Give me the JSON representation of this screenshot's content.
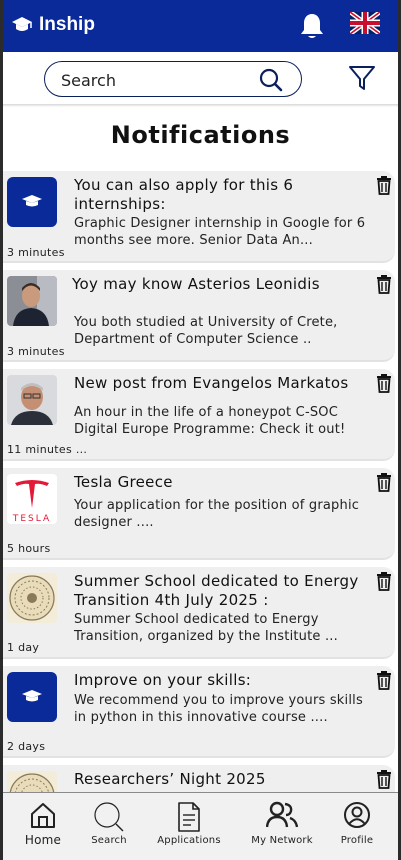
{
  "app": {
    "name": "Inship"
  },
  "search": {
    "placeholder": "Search"
  },
  "page": {
    "title": "Notifications"
  },
  "notifications": [
    {
      "title": "You can also apply for this 6 internships:",
      "body": "Graphic Designer internship in Google for 6 months see more. Senior Data An...",
      "time": "3 minutes",
      "icon": "graduation-cap-icon"
    },
    {
      "title": "Yoy may know Asterios Leonidis",
      "body": "You both studied at University of Crete, Department of Computer Science ..",
      "time": "3 minutes",
      "icon": "person-photo"
    },
    {
      "title": "New post from Evangelos  Markatos",
      "body": "An hour in the life of a honeypot C-SOC Digital Europe Programme: Check it out!",
      "time": "11 minutes ...",
      "icon": "person-photo"
    },
    {
      "title": "Tesla Greece",
      "body": "Your application for the position of graphic designer ....",
      "time": "5 hours",
      "icon": "tesla-logo",
      "logo_text": "TESLA"
    },
    {
      "title": "Summer School dedicated to Energy Transition 4th July 2025 :",
      "body": "Summer School dedicated to Energy Transition, organized by the Institute ...",
      "time": "1 day",
      "icon": "seal-logo"
    },
    {
      "title": "Improve on your skills:",
      "body": "We recommend you to improve yours skills in python in this innovative course ....",
      "time": "2 days",
      "icon": "graduation-cap-icon"
    },
    {
      "title": "Researchers’ Night 2025",
      "body": "",
      "time": "",
      "icon": "seal-logo"
    }
  ],
  "nav": {
    "items": [
      {
        "label": "Home",
        "icon": "home-icon"
      },
      {
        "label": "Search",
        "icon": "search-icon"
      },
      {
        "label": "Applications",
        "icon": "document-icon"
      },
      {
        "label": "My Network",
        "icon": "people-icon"
      },
      {
        "label": "Profile",
        "icon": "profile-icon"
      }
    ]
  },
  "colors": {
    "brand": "#0a2a9a",
    "card_bg": "#efefef",
    "tesla_red": "#e31937"
  }
}
